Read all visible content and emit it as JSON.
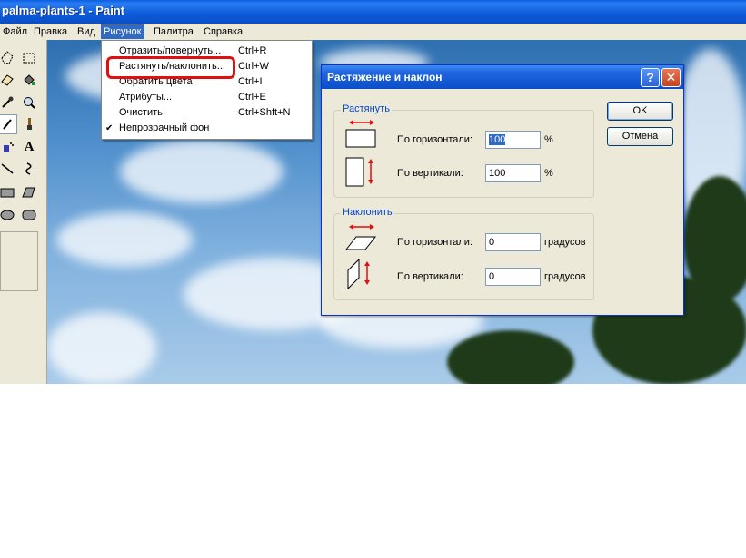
{
  "window": {
    "title": "palma-plants-1 - Paint"
  },
  "menubar": {
    "items": [
      "Файл",
      "Правка",
      "Вид",
      "Рисунок",
      "Палитра",
      "Справка"
    ],
    "active_index": 3
  },
  "image_menu": {
    "items": [
      {
        "label": "Отразить/повернуть...",
        "shortcut": "Ctrl+R"
      },
      {
        "label": "Растянуть/наклонить...",
        "shortcut": "Ctrl+W"
      },
      {
        "label": "Обратить цвета",
        "shortcut": "Ctrl+I"
      },
      {
        "label": "Атрибуты...",
        "shortcut": "Ctrl+E"
      },
      {
        "label": "Очистить",
        "shortcut": "Ctrl+Shft+N"
      },
      {
        "label": "Непрозрачный фон",
        "shortcut": "",
        "checked": true
      }
    ],
    "highlighted_index": 1,
    "check_mark": "✔"
  },
  "dialog": {
    "title": "Растяжение и наклон",
    "help_label": "?",
    "close_label": "✕",
    "stretch": {
      "group_label": "Растянуть",
      "horizontal_label": "По горизонтали:",
      "horizontal_value": "100",
      "vertical_label": "По вертикали:",
      "vertical_value": "100",
      "unit": "%"
    },
    "skew": {
      "group_label": "Наклонить",
      "horizontal_label": "По горизонтали:",
      "horizontal_value": "0",
      "vertical_label": "По вертикали:",
      "vertical_value": "0",
      "unit": "градусов"
    },
    "ok_label": "OK",
    "cancel_label": "Отмена"
  },
  "colors": {
    "titlebar": "#0a5fe0",
    "menu_highlight": "#316ac5",
    "annotation": "#e01010",
    "group_title": "#0046d5",
    "arrow": "#e01010"
  },
  "toolbox": {
    "tools": [
      "free-select-icon",
      "rect-select-icon",
      "eraser-icon",
      "fill-icon",
      "color-picker-icon",
      "magnifier-icon",
      "pencil-icon",
      "brush-icon",
      "airbrush-icon",
      "text-icon",
      "line-icon",
      "curve-icon",
      "rectangle-icon",
      "polygon-icon",
      "ellipse-icon",
      "rounded-rect-icon"
    ],
    "active_tool": "pencil-icon"
  }
}
